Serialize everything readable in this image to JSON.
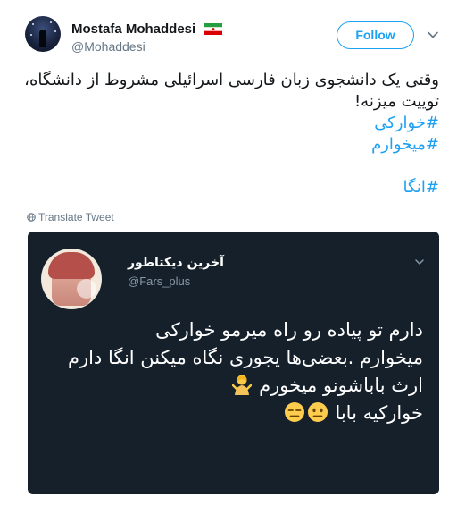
{
  "author": {
    "display_name": "Mostafa Mohaddesi",
    "handle": "@Mohaddesi",
    "flag_icon": "iran-flag-icon"
  },
  "follow_button": {
    "label": "Follow",
    "color": "#1da1f2"
  },
  "tweet": {
    "lines": [
      "وقتی یک دانشجوی زبان فارسی اسرائیلی مشروط از دانشگاه،",
      "توییت میزنه!"
    ],
    "hashtags": [
      "#خوارکی",
      "#میخوارم"
    ],
    "hashtag_last": "#انگا"
  },
  "translate_label": "Translate Tweet",
  "quoted_tweet": {
    "display_name": "آخرین دیکتاطور",
    "handle": "@Fars_plus",
    "lines": [
      "دارم تو پیاده رو راه میرمو خوارکی",
      "میخوارم .بعضی‌ها یجوری نگاه میکنن انگا دارم",
      "ارث باباشونو میخورم",
      "خوارکیه بابا"
    ],
    "background": "#15202b"
  }
}
